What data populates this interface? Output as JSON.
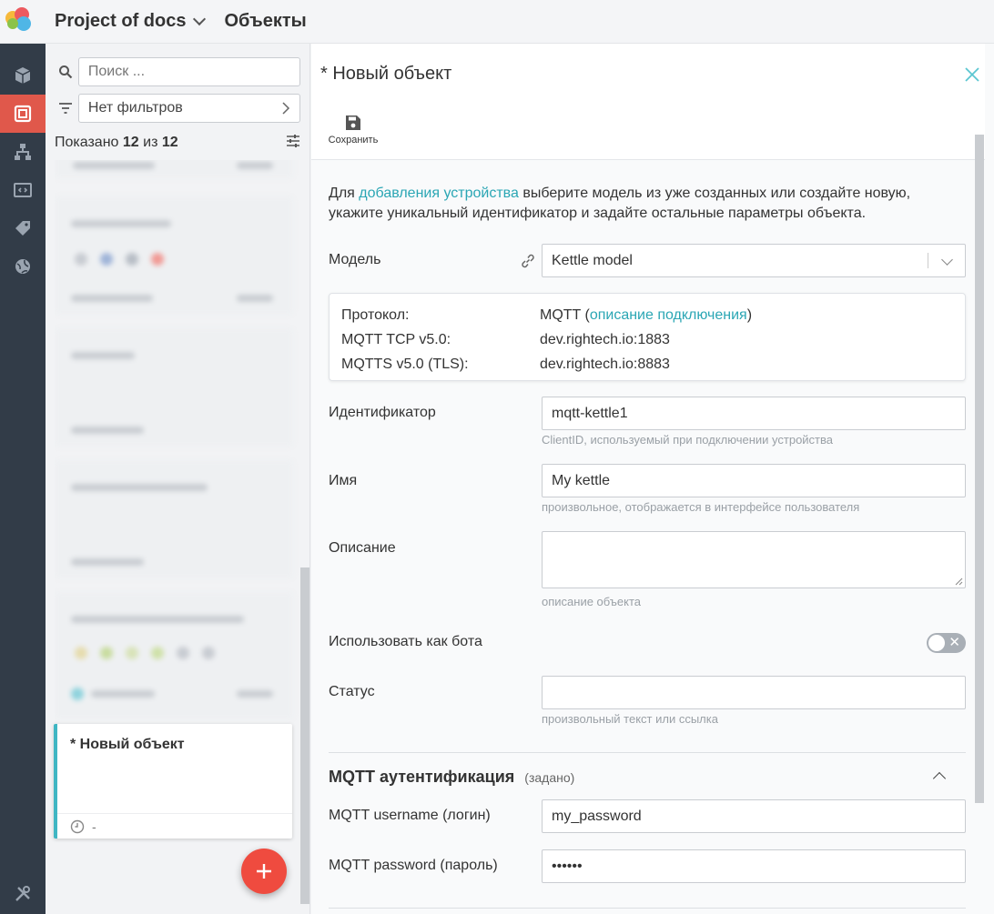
{
  "header": {
    "project": "Project of docs",
    "section": "Объекты"
  },
  "colors": {
    "accent": "#2aa6b4",
    "rail": "#323c48",
    "rail_active": "#e0584b",
    "fab": "#ef4b3f"
  },
  "rail": {
    "items": [
      {
        "icon": "cube-icon"
      },
      {
        "icon": "objects-icon"
      },
      {
        "icon": "hierarchy-icon"
      },
      {
        "icon": "code-window-icon"
      },
      {
        "icon": "tag-icon"
      },
      {
        "icon": "globe-icon"
      }
    ],
    "bottom_icon": "tools-icon"
  },
  "list": {
    "search_placeholder": "Поиск ...",
    "filter_label": "Нет фильтров",
    "shown_prefix": "Показано",
    "shown_count": "12",
    "shown_of": "из",
    "shown_total": "12",
    "new_card_title": "* Новый объект",
    "new_card_time": "-"
  },
  "detail": {
    "title": "* Новый объект",
    "save_label": "Сохранить",
    "intro_pre": "Для ",
    "intro_link": "добавления устройства",
    "intro_post": " выберите модель из уже созданных или создайте новую, укажите уникальный идентификатор и задайте остальные параметры объекта.",
    "model_label": "Модель",
    "model_value": "Kettle model",
    "protocol": {
      "label1": "Протокол:",
      "value1_pre": "MQTT (",
      "value1_link": "описание подключения",
      "value1_post": ")",
      "label2": "MQTT TCP v5.0:",
      "value2": "dev.rightech.io:1883",
      "label3": "MQTTS v5.0 (TLS):",
      "value3": "dev.rightech.io:8883"
    },
    "id_label": "Идентификатор",
    "id_value": "mqtt-kettle1",
    "id_hint": "ClientID, используемый при подключении устройства",
    "name_label": "Имя",
    "name_value": "My kettle",
    "name_hint": "произвольное, отображается в интерфейсе пользователя",
    "desc_label": "Описание",
    "desc_value": "",
    "desc_hint": "описание объекта",
    "bot_label": "Использовать как бота",
    "bot_toggle_glyph": "✕",
    "status_label": "Статус",
    "status_value": "",
    "status_hint": "произвольный текст или ссылка",
    "auth_title": "MQTT аутентификация",
    "auth_sub": "(задано)",
    "username_label": "MQTT username (логин)",
    "username_value": "my_password",
    "password_label": "MQTT password (пароль)",
    "password_value": "••••••"
  }
}
